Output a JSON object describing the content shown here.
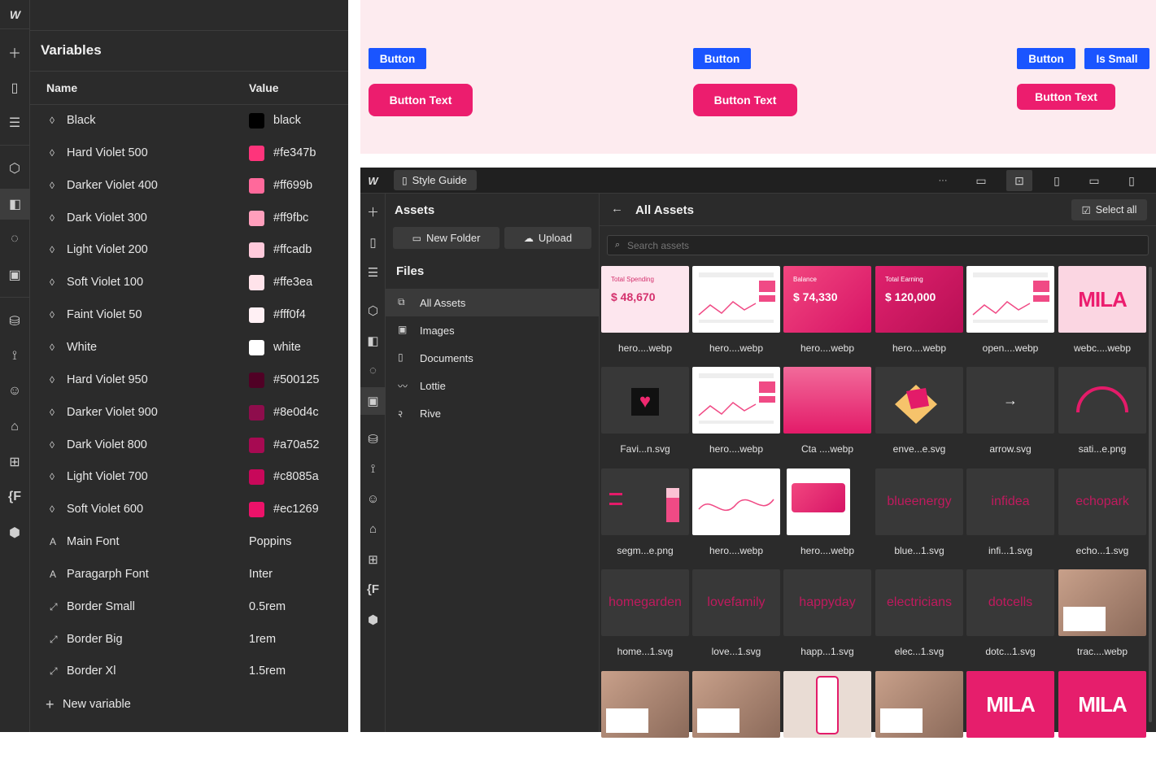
{
  "left": {
    "title": "Variables",
    "col_name": "Name",
    "col_value": "Value",
    "variables": [
      {
        "name": "Black",
        "value": "black",
        "color": "#000000"
      },
      {
        "name": "Hard Violet 500",
        "value": "#fe347b",
        "color": "#fe347b"
      },
      {
        "name": "Darker Violet 400",
        "value": "#ff699b",
        "color": "#ff699b"
      },
      {
        "name": "Dark Violet 300",
        "value": "#ff9fbc",
        "color": "#ff9fbc"
      },
      {
        "name": "Light Violet 200",
        "value": "#ffcadb",
        "color": "#ffcadb"
      },
      {
        "name": "Soft Violet 100",
        "value": "#ffe3ea",
        "color": "#ffe3ea"
      },
      {
        "name": "Faint Violet 50",
        "value": "#fff0f4",
        "color": "#fff0f4"
      },
      {
        "name": "White",
        "value": "white",
        "color": "#ffffff"
      },
      {
        "name": "Hard Violet 950",
        "value": "#500125",
        "color": "#500125"
      },
      {
        "name": "Darker Violet 900",
        "value": "#8e0d4c",
        "color": "#8e0d4c"
      },
      {
        "name": "Dark Violet 800",
        "value": "#a70a52",
        "color": "#a70a52"
      },
      {
        "name": "Light Violet 700",
        "value": "#c8085a",
        "color": "#c8085a"
      },
      {
        "name": "Soft Violet 600",
        "value": "#ec1269",
        "color": "#ec1269"
      },
      {
        "name": "Main Font",
        "value": "Poppins",
        "color": ""
      },
      {
        "name": "Paragarph Font",
        "value": "Inter",
        "color": ""
      },
      {
        "name": "Border Small",
        "value": "0.5rem",
        "color": ""
      },
      {
        "name": "Border Big",
        "value": "1rem",
        "color": ""
      },
      {
        "name": "Border Xl",
        "value": "1.5rem",
        "color": ""
      }
    ],
    "new_variable": "New variable"
  },
  "preview": {
    "button": "Button",
    "button_text": "Button Text",
    "is_small": "Is Small"
  },
  "app": {
    "page_name": "Style Guide",
    "more": "···",
    "assets_title": "Assets",
    "new_folder": "New Folder",
    "upload": "Upload",
    "files_title": "Files",
    "files": [
      "All Assets",
      "Images",
      "Documents",
      "Lottie",
      "Rive"
    ],
    "grid_title": "All Assets",
    "select_all": "Select all",
    "search_placeholder": "Search assets",
    "assets": [
      {
        "name": "hero....webp",
        "thumb": "spend",
        "title": "Total Spending",
        "value": "$ 48,670"
      },
      {
        "name": "hero....webp",
        "thumb": "dash"
      },
      {
        "name": "hero....webp",
        "thumb": "balance",
        "title": "Balance",
        "value": "$ 74,330"
      },
      {
        "name": "hero....webp",
        "thumb": "earning",
        "title": "Total Earning",
        "value": "$ 120,000"
      },
      {
        "name": "open....webp",
        "thumb": "dash"
      },
      {
        "name": "webc....webp",
        "thumb": "mila-light",
        "value": "MILA"
      },
      {
        "name": "Favi...n.svg",
        "thumb": "heart"
      },
      {
        "name": "hero....webp",
        "thumb": "dash"
      },
      {
        "name": "Cta ....webp",
        "thumb": "cta"
      },
      {
        "name": "enve...e.svg",
        "thumb": "envelope"
      },
      {
        "name": "arrow.svg",
        "thumb": "arrow"
      },
      {
        "name": "sati...e.png",
        "thumb": "gauge"
      },
      {
        "name": "segm...e.png",
        "thumb": "segment"
      },
      {
        "name": "hero....webp",
        "thumb": "wave"
      },
      {
        "name": "hero....webp",
        "thumb": "bank"
      },
      {
        "name": "blue...1.svg",
        "thumb": "logo",
        "value": "blueenergy"
      },
      {
        "name": "infi...1.svg",
        "thumb": "logo",
        "value": "infidea"
      },
      {
        "name": "echo...1.svg",
        "thumb": "logo",
        "value": "echopark"
      },
      {
        "name": "home...1.svg",
        "thumb": "logo",
        "value": "homegarden"
      },
      {
        "name": "love...1.svg",
        "thumb": "logo",
        "value": "lovefamily"
      },
      {
        "name": "happ...1.svg",
        "thumb": "logo",
        "value": "happyday"
      },
      {
        "name": "elec...1.svg",
        "thumb": "logo",
        "value": "electricians"
      },
      {
        "name": "dotc...1.svg",
        "thumb": "logo",
        "value": "dotcells"
      },
      {
        "name": "trac....webp",
        "thumb": "photo"
      },
      {
        "name": "",
        "thumb": "photo"
      },
      {
        "name": "",
        "thumb": "photo"
      },
      {
        "name": "",
        "thumb": "phone"
      },
      {
        "name": "",
        "thumb": "photo"
      },
      {
        "name": "",
        "thumb": "mila-dark",
        "value": "MILA"
      },
      {
        "name": "",
        "thumb": "mila-dark",
        "value": "MILA"
      }
    ]
  },
  "colors": {
    "accent_pink": "#ec1d6e",
    "accent_blue": "#1a55ff",
    "panel_bg": "#2b2b2b",
    "preview_bg": "#fdebef"
  }
}
